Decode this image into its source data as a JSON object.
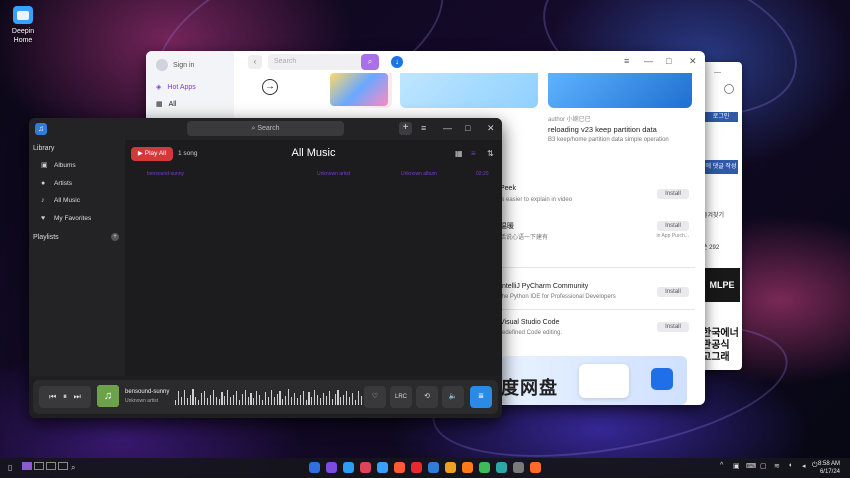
{
  "desktop": {
    "icon_label_line1": "Deepin",
    "icon_label_line2": "Home"
  },
  "back_window": {
    "btn1": "로그인",
    "btn2": "에 댓글 작성",
    "text1": "즐겨찾기",
    "text2": "쓴 292",
    "mlpe": "MLPE",
    "korean1": "한국에너",
    "korean2": "관공식",
    "korean3": "고그래"
  },
  "store": {
    "signin": "Sign in",
    "nav_hot": "Hot Apps",
    "nav_all": "All",
    "search_placeholder": "Search",
    "article_author": "author 小婉已已",
    "article_title": "reloading v23 keep partition data",
    "article_sub": "B3 keep/home partition data simple operation",
    "apps": [
      {
        "name": "Peek",
        "desc": "is easier to explain in video",
        "btn": "Install"
      },
      {
        "name": "温暖",
        "desc": "活说心语一下建有",
        "btn": "Install",
        "extra": "in App Purch..."
      },
      {
        "name": "IntelliJ PyCharm Community",
        "desc": "the Python IDE for Professional Developers",
        "btn": "Install"
      },
      {
        "name": "Visual Studio Code",
        "desc": "redefined Code editing.",
        "btn": "Install"
      }
    ],
    "promo_text": "度网盘"
  },
  "music": {
    "search_label": "Search",
    "library_heading": "Library",
    "nav": [
      {
        "label": "Albums",
        "icon": "album-icon"
      },
      {
        "label": "Artists",
        "icon": "person-icon"
      },
      {
        "label": "All Music",
        "icon": "note-icon"
      },
      {
        "label": "My Favorites",
        "icon": "heart-icon"
      }
    ],
    "playlists_heading": "Playlists",
    "play_all": "Play All",
    "song_count": "1 song",
    "title": "All Music",
    "song_row": {
      "title": "bensound-sunny",
      "artist": "Unknown artist",
      "album": "Unknown album",
      "duration": "02:20"
    },
    "now_playing": {
      "track": "bensound-sunny",
      "artist": "Unknown artist"
    },
    "lrc_label": "LRC",
    "waveform": [
      0.3,
      0.8,
      0.5,
      0.9,
      0.4,
      0.6,
      0.95,
      0.5,
      0.3,
      0.7,
      0.85,
      0.4,
      0.6,
      0.9,
      0.5,
      0.35,
      0.75,
      0.55,
      0.9,
      0.45,
      0.6,
      0.8,
      0.3,
      0.65,
      0.9,
      0.5,
      0.7,
      0.4,
      0.85,
      0.6,
      0.3,
      0.75,
      0.5,
      0.9,
      0.45,
      0.65,
      0.8,
      0.35,
      0.55,
      0.95,
      0.5,
      0.7,
      0.4,
      0.6,
      0.85,
      0.3,
      0.75,
      0.5,
      0.9,
      0.6,
      0.4,
      0.7,
      0.55,
      0.85,
      0.35,
      0.65,
      0.9,
      0.45,
      0.6,
      0.8,
      0.5,
      0.7,
      0.3,
      0.85,
      0.55,
      0.4
    ]
  },
  "taskbar": {
    "clock_time": "8:58 AM",
    "clock_date": "6/17/24",
    "dock_colors": [
      "#2f6fe0",
      "#7d4be0",
      "#2a9df4",
      "#e0425a",
      "#3aa0ff",
      "#ff5a36",
      "#e8292f",
      "#2f7dd6",
      "#f0a020",
      "#ff7a1a",
      "#3dbb58",
      "#2da6a6",
      "#7a7a7a",
      "#ff6a2a"
    ]
  }
}
